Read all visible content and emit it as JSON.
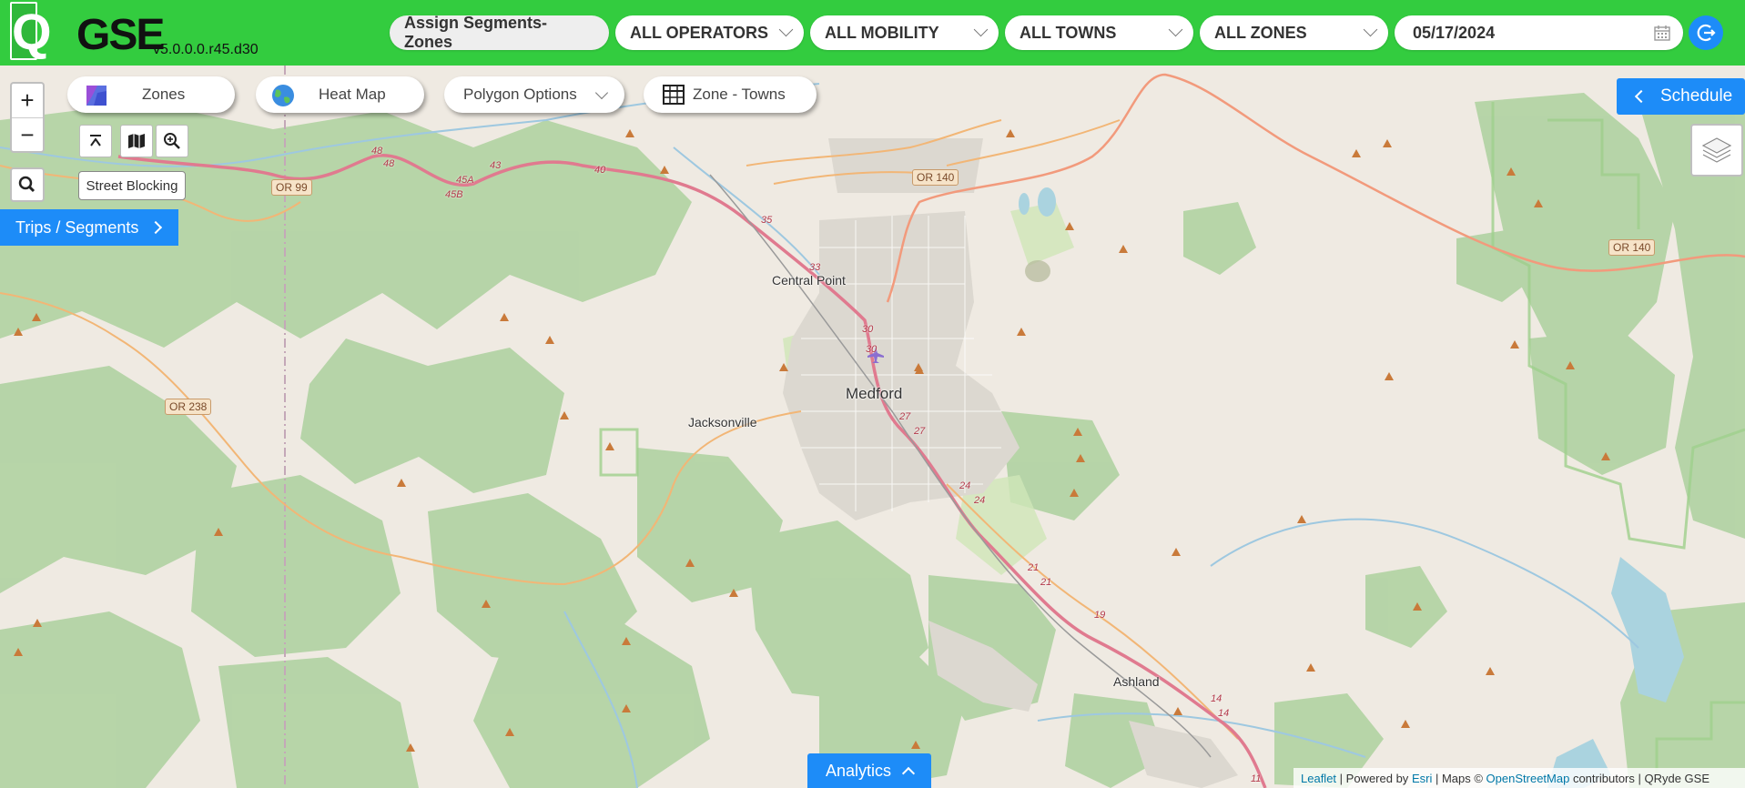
{
  "app": {
    "logo_letter": "Q",
    "logo_text": "GSE",
    "version": "v5.0.0.0.r45.d30"
  },
  "header": {
    "assign_button": "Assign Segments-Zones",
    "operators": "ALL OPERATORS",
    "mobility": "ALL MOBILITY",
    "towns": "ALL TOWNS",
    "zones": "ALL ZONES",
    "date": "05/17/2024"
  },
  "map_tools": {
    "zoom_in": "+",
    "zoom_out": "−",
    "zones_label": "Zones",
    "heatmap_label": "Heat Map",
    "polygon_label": "Polygon Options",
    "zone_towns_label": "Zone - Towns",
    "street_blocking": "Street Blocking"
  },
  "buttons": {
    "trips_segments": "Trips / Segments",
    "schedule": "Schedule",
    "analytics": "Analytics"
  },
  "map_labels": {
    "medford": "Medford",
    "central_point": "Central Point",
    "jacksonville": "Jacksonville",
    "ashland": "Ashland",
    "or99": "OR 99",
    "or140a": "OR 140",
    "or140b": "OR 140",
    "or238": "OR 238"
  },
  "exits": [
    "48",
    "48",
    "45A",
    "45B",
    "43",
    "40",
    "35",
    "33",
    "30",
    "30",
    "27",
    "27",
    "24",
    "24",
    "21",
    "21",
    "19",
    "14",
    "14",
    "11"
  ],
  "attribution": {
    "leaflet": "Leaflet",
    "powered": "| Powered by",
    "esri": "Esri",
    "maps": "| Maps ©",
    "osm": "OpenStreetMap",
    "rest": "contributors | QRyde GSE"
  },
  "colors": {
    "header_green": "#33cc3f",
    "accent_blue": "#1d8cf8",
    "forest_green": "#add19e",
    "interstate_pink": "#e07a8f"
  }
}
